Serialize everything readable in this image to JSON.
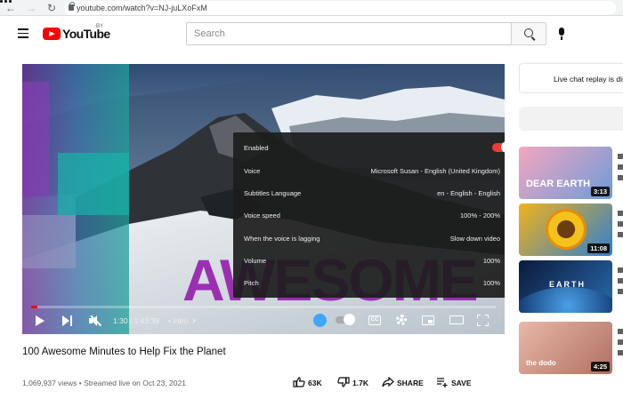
{
  "browser": {
    "url": "youtube.com/watch?v=NJ-juLXoFxM"
  },
  "header": {
    "logo_text": "YouTube",
    "logo_region": "BY",
    "search_placeholder": "Search"
  },
  "player": {
    "overlay_text": "AWESOME",
    "progress_fraction": 0.014,
    "time_display": "1:30 / 1:43:39",
    "chapter_label": "Intro",
    "settings": [
      {
        "label": "Enabled",
        "value": "",
        "toggle": true
      },
      {
        "label": "Voice",
        "value": "Microsoft Susan - English (United Kingdom)"
      },
      {
        "label": "Subtitles Language",
        "value": "en - English - English"
      },
      {
        "label": "Voice speed",
        "value": "100% - 200%"
      },
      {
        "label": "When the voice is lagging",
        "value": "Slow down video"
      },
      {
        "label": "Volume",
        "value": "100%"
      },
      {
        "label": "Pitch",
        "value": "100%"
      }
    ],
    "cc_label": "CC"
  },
  "video": {
    "title": "100 Awesome Minutes to Help Fix the Planet",
    "meta": "1,069,937 views • Streamed live on Oct 23, 2021",
    "likes": "63K",
    "dislikes": "1.7K",
    "share_label": "SHARE",
    "save_label": "SAVE"
  },
  "sidebar": {
    "chat_replay_label": "Live chat replay is disabled",
    "recommendations": [
      {
        "caption": "DEAR EARTH",
        "duration": "3:13",
        "colors": [
          "#f4a6c0",
          "#6d9bd8"
        ]
      },
      {
        "caption": "",
        "duration": "11:08",
        "colors": [
          "#f2b21a",
          "#2f7fd0"
        ]
      },
      {
        "caption": "EARTH",
        "duration": "",
        "colors": [
          "#0b1a3a",
          "#2a6bb0"
        ]
      },
      {
        "caption": "the dodo",
        "duration": "4:25",
        "colors": [
          "#e8b8a8",
          "#b07060"
        ]
      }
    ]
  },
  "colors": {
    "brand_red": "#ff0000",
    "toggle_on": "#f03a35",
    "settings_bg": "#1c1c1c"
  }
}
